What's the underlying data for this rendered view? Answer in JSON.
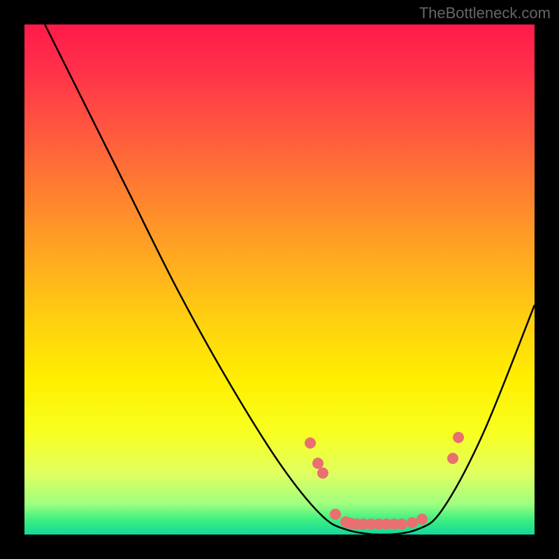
{
  "watermark": "TheBottleneck.com",
  "chart_data": {
    "type": "line",
    "title": "",
    "xlabel": "",
    "ylabel": "",
    "x_range": [
      0,
      100
    ],
    "y_range": [
      0,
      100
    ],
    "curve": {
      "name": "bottleneck-curve",
      "points": [
        {
          "x": 4,
          "y": 100
        },
        {
          "x": 10,
          "y": 88
        },
        {
          "x": 20,
          "y": 68
        },
        {
          "x": 30,
          "y": 48
        },
        {
          "x": 40,
          "y": 30
        },
        {
          "x": 50,
          "y": 14
        },
        {
          "x": 58,
          "y": 4
        },
        {
          "x": 63,
          "y": 1
        },
        {
          "x": 70,
          "y": 0
        },
        {
          "x": 77,
          "y": 1
        },
        {
          "x": 82,
          "y": 5
        },
        {
          "x": 90,
          "y": 20
        },
        {
          "x": 100,
          "y": 45
        }
      ]
    },
    "highlight_dots": [
      {
        "x": 56,
        "y": 18
      },
      {
        "x": 57.5,
        "y": 14
      },
      {
        "x": 58.5,
        "y": 12
      },
      {
        "x": 61,
        "y": 4
      },
      {
        "x": 63,
        "y": 2.5
      },
      {
        "x": 64,
        "y": 2.2
      },
      {
        "x": 65,
        "y": 2
      },
      {
        "x": 66.5,
        "y": 2
      },
      {
        "x": 68,
        "y": 2
      },
      {
        "x": 69.5,
        "y": 2
      },
      {
        "x": 71,
        "y": 2
      },
      {
        "x": 72.5,
        "y": 2
      },
      {
        "x": 74,
        "y": 2
      },
      {
        "x": 76,
        "y": 2.3
      },
      {
        "x": 78,
        "y": 3
      },
      {
        "x": 84,
        "y": 15
      },
      {
        "x": 85,
        "y": 19
      }
    ],
    "gradient_colors": {
      "top": "#ff1a4a",
      "mid": "#fff000",
      "bottom": "#10d8a0"
    }
  }
}
